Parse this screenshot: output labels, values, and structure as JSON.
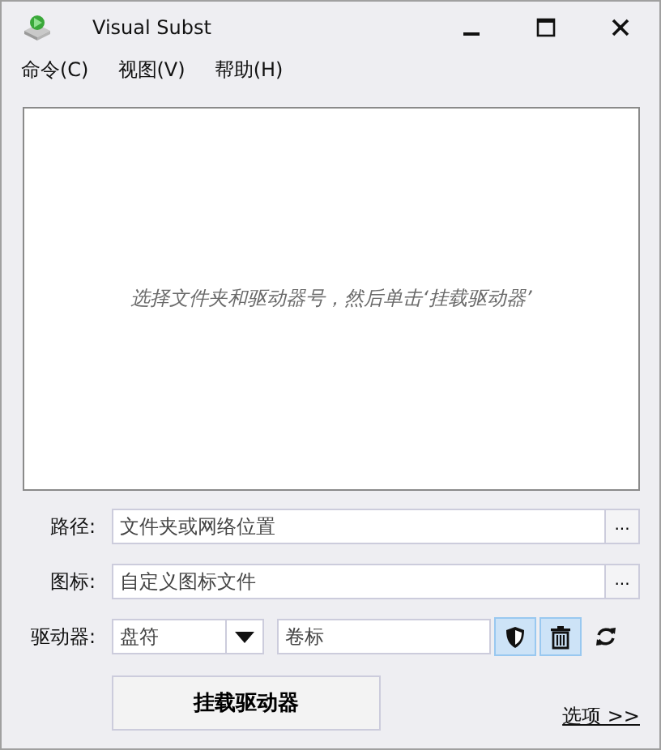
{
  "window": {
    "title": "Visual Subst"
  },
  "menu": [
    {
      "label": "命令(C)"
    },
    {
      "label": "视图(V)"
    },
    {
      "label": "帮助(H)"
    }
  ],
  "drive_list": {
    "empty_message": "选择文件夹和驱动器号，然后单击‘挂载驱动器’"
  },
  "path": {
    "label": "路径:",
    "placeholder": "文件夹或网络位置",
    "browse": "..."
  },
  "icon": {
    "label": "图标:",
    "placeholder": "自定义图标文件",
    "browse": "..."
  },
  "drive": {
    "label": "驱动器:",
    "letter_placeholder": "盘符",
    "volume_placeholder": "卷标",
    "tools": [
      {
        "kind": "shield",
        "highlighted": true
      },
      {
        "kind": "trash",
        "highlighted": true
      },
      {
        "kind": "refresh",
        "highlighted": false
      }
    ]
  },
  "mount_button": "挂载驱动器",
  "options_link": "选项 >>"
}
